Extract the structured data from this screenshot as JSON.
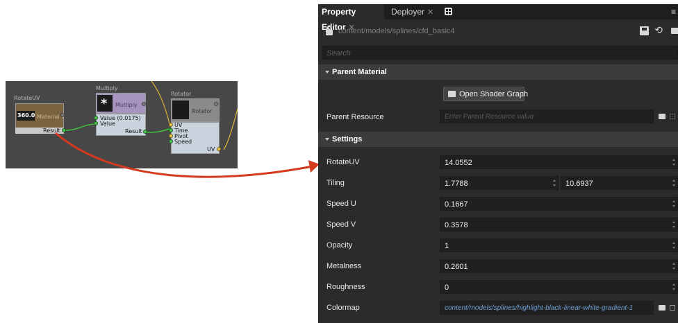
{
  "graph": {
    "rotate_node": {
      "title": "RotateUV",
      "value": "360.0",
      "material_label": "Material V",
      "output": "Result"
    },
    "multiply_node": {
      "title": "Multiply",
      "symbol": "*",
      "label": "Multiply",
      "input1": "Value (0.0175)",
      "input2": "Value",
      "output": "Result"
    },
    "rotator_node": {
      "title": "Rotator",
      "label": "Rotator",
      "inputs": [
        "UV",
        "Time",
        "Pivot",
        "Speed"
      ],
      "output": "UV"
    }
  },
  "editor": {
    "tabs": [
      {
        "label": "Property Editor",
        "close": "✕"
      },
      {
        "label": "Deployer",
        "close": "✕"
      }
    ],
    "menu_icon": "≡",
    "path": "content/models/splines/cfd_basic4",
    "search_placeholder": "Search",
    "parent_material": {
      "header": "Parent Material",
      "open_button": "Open Shader Graph",
      "resource_label": "Parent Resource",
      "resource_placeholder": "Enter Parent Resource value"
    },
    "settings": {
      "header": "Settings",
      "rotateuv": {
        "label": "RotateUV",
        "value": "14.0552"
      },
      "tiling": {
        "label": "Tiling",
        "x": "1.7788",
        "y": "10.6937"
      },
      "speed_u": {
        "label": "Speed U",
        "value": "0.1667"
      },
      "speed_v": {
        "label": "Speed V",
        "value": "0.3578"
      },
      "opacity": {
        "label": "Opacity",
        "value": "1"
      },
      "metalness": {
        "label": "Metalness",
        "value": "0.2601"
      },
      "roughness": {
        "label": "Roughness",
        "value": "0"
      },
      "colormap": {
        "label": "Colormap",
        "value": "content/models/splines/highlight-black-linear-white-gradient-1"
      }
    }
  },
  "colors": {
    "arrow": "#d33a1e",
    "wire": "#3fbf3f",
    "panel_bg": "#2b2b2b",
    "link": "#6f9fd6"
  }
}
